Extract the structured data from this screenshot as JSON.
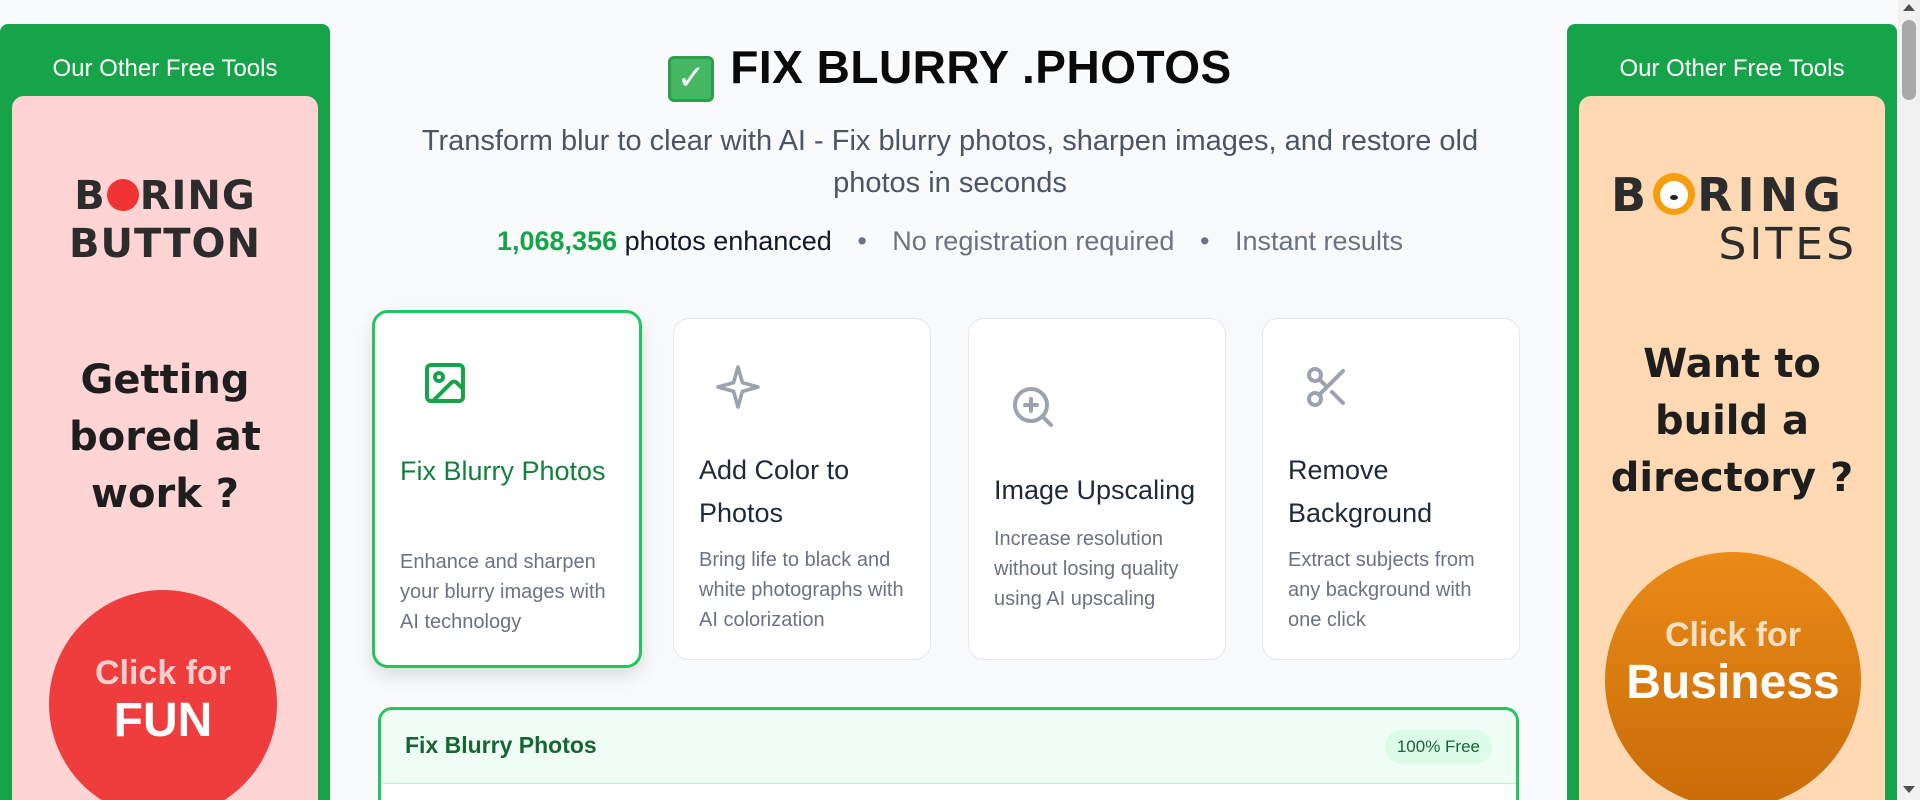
{
  "left_ad": {
    "header": "Our Other Free Tools",
    "brand_part1": "B",
    "brand_part2": "RING",
    "brand_line2": "BUTTON",
    "question_line1": "Getting",
    "question_line2": "bored at",
    "question_line3": "work ?",
    "cta_small": "Click for",
    "cta_big": "FUN"
  },
  "right_ad": {
    "header": "Our Other Free Tools",
    "brand_part1": "B",
    "brand_part2": "RING",
    "brand_line2": "SITES",
    "question_line1": "Want to",
    "question_line2": "build a",
    "question_line3": "directory ?",
    "cta_small": "Click for",
    "cta_big": "Business"
  },
  "header": {
    "title": "FIX BLURRY .PHOTOS",
    "subtitle": "Transform blur to clear with AI - Fix blurry photos, sharpen images, and restore old photos in seconds"
  },
  "stats": {
    "count": "1,068,356",
    "count_label": "photos enhanced",
    "sep": "•",
    "item2": "No registration required",
    "item3": "Instant results"
  },
  "tools": [
    {
      "name": "Fix Blurry Photos",
      "desc": "Enhance and sharpen your blurry images with AI technology",
      "icon": "image-icon",
      "active": true
    },
    {
      "name": "Add Color to Photos",
      "desc": "Bring life to black and white photographs with AI colorization",
      "icon": "sparkle-icon",
      "active": false
    },
    {
      "name": "Image Upscaling",
      "desc": "Increase resolution without losing quality using AI upscaling",
      "icon": "zoom-in-icon",
      "active": false
    },
    {
      "name": "Remove Background",
      "desc": "Extract subjects from any background with one click",
      "icon": "scissors-icon",
      "active": false
    }
  ],
  "panel": {
    "title": "Fix Blurry Photos",
    "badge": "100% Free"
  },
  "colors": {
    "accent": "#16a34a",
    "active_border": "#22c55e",
    "left_ad_bg": "#fed4d4",
    "right_ad_bg": "#fed9b3"
  }
}
